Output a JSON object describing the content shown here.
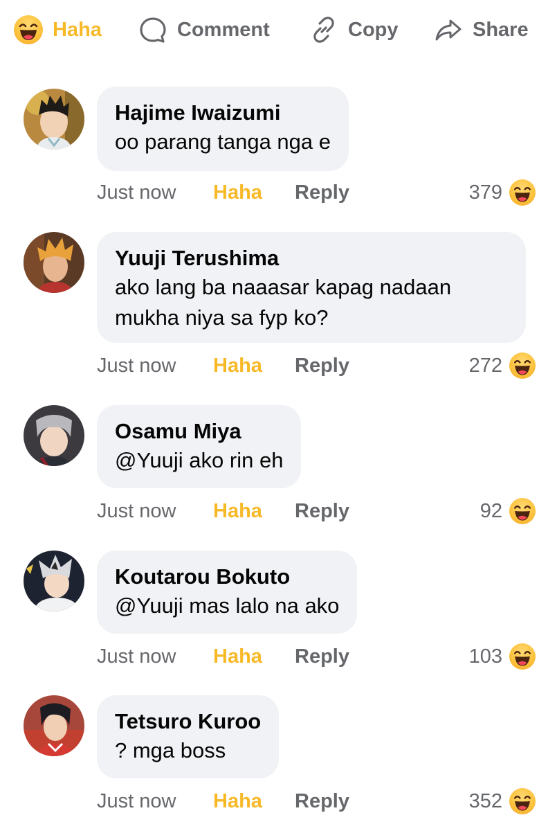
{
  "actions": {
    "haha": "Haha",
    "comment": "Comment",
    "copy": "Copy",
    "share": "Share"
  },
  "colors": {
    "haha_accent": "#f7b928",
    "muted": "#65676b",
    "bubble_bg": "#f0f2f5"
  },
  "comments": [
    {
      "name": "Hajime Iwaizumi",
      "lines": [
        "oo parang tanga nga e"
      ],
      "time": "Just now",
      "reaction": "Haha",
      "reply": "Reply",
      "count": "379"
    },
    {
      "name": "Yuuji Terushima",
      "lines": [
        "ako lang ba naaasar kapag nadaan",
        "mukha niya sa fyp ko?"
      ],
      "time": "Just now",
      "reaction": "Haha",
      "reply": "Reply",
      "count": "272"
    },
    {
      "name": "Osamu Miya",
      "lines": [
        "@Yuuji ako rin eh"
      ],
      "time": "Just now",
      "reaction": "Haha",
      "reply": "Reply",
      "count": "92"
    },
    {
      "name": "Koutarou Bokuto",
      "lines": [
        "@Yuuji mas lalo na ako"
      ],
      "time": "Just now",
      "reaction": "Haha",
      "reply": "Reply",
      "count": "103"
    },
    {
      "name": "Tetsuro Kuroo",
      "lines": [
        "? mga boss"
      ],
      "time": "Just now",
      "reaction": "Haha",
      "reply": "Reply",
      "count": "352"
    }
  ]
}
